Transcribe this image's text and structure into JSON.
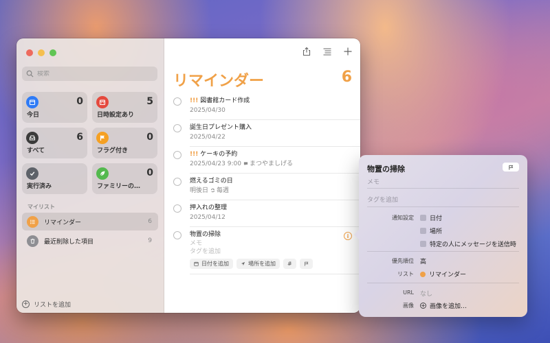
{
  "colors": {
    "accent": "#f0a148",
    "today": "#2f7bf6",
    "scheduled": "#e5493d",
    "all": "#3b3b3b",
    "flagged": "#f5a023",
    "completed": "#5e6269",
    "family": "#54b94e",
    "list_reminders": "#f0a148",
    "list_deleted": "#8e8e93"
  },
  "search": {
    "placeholder": "検索"
  },
  "smart_lists": [
    {
      "label": "今日",
      "count": "0",
      "icon": "calendar-icon"
    },
    {
      "label": "日時設定あり",
      "count": "5",
      "icon": "calendar-grid-icon"
    },
    {
      "label": "すべて",
      "count": "6",
      "icon": "tray-icon"
    },
    {
      "label": "フラグ付き",
      "count": "0",
      "icon": "flag-icon"
    },
    {
      "label": "実行済み",
      "count": "",
      "icon": "checkmark-icon"
    },
    {
      "label": "ファミリーの…",
      "count": "0",
      "icon": "leaf-icon"
    }
  ],
  "my_lists": {
    "section_label": "マイリスト",
    "items": [
      {
        "label": "リマインダー",
        "count": "6",
        "icon": "list-icon"
      },
      {
        "label": "最近削除した項目",
        "count": "9",
        "icon": "trash-icon"
      }
    ]
  },
  "add_list_label": "リストを追加",
  "main": {
    "title": "リマインダー",
    "count": "6",
    "reminders": [
      {
        "priority": "!!!",
        "title": "図書館カード作成",
        "detail": "2025/04/30"
      },
      {
        "priority": "",
        "title": "誕生日プレゼント購入",
        "detail": "2025/04/22"
      },
      {
        "priority": "!!!",
        "title": "ケーキの予約",
        "detail": "2025/04/23 9:00",
        "extra": "まつやましげる"
      },
      {
        "priority": "",
        "title": "燃えるゴミの日",
        "detail": "明後日",
        "extra": "毎週"
      },
      {
        "priority": "",
        "title": "押入れの整理",
        "detail": "2025/04/12"
      },
      {
        "priority": "",
        "title": "物置の掃除",
        "note_placeholder": "メモ",
        "tag_placeholder": "タグを追加",
        "chips": {
          "date": "日付を追加",
          "location": "場所を追加",
          "tag": "#"
        }
      }
    ]
  },
  "popover": {
    "title": "物置の掃除",
    "memo_placeholder": "メモ",
    "tag_placeholder": "タグを追加",
    "notify_label": "通知設定",
    "notify_date": "日付",
    "notify_location": "場所",
    "notify_message": "特定の人にメッセージを送信時",
    "priority_label": "優先順位",
    "priority_value": "高",
    "list_label": "リスト",
    "list_value": "リマインダー",
    "url_label": "URL",
    "url_value": "なし",
    "image_label": "画像",
    "image_value": "画像を追加…"
  }
}
